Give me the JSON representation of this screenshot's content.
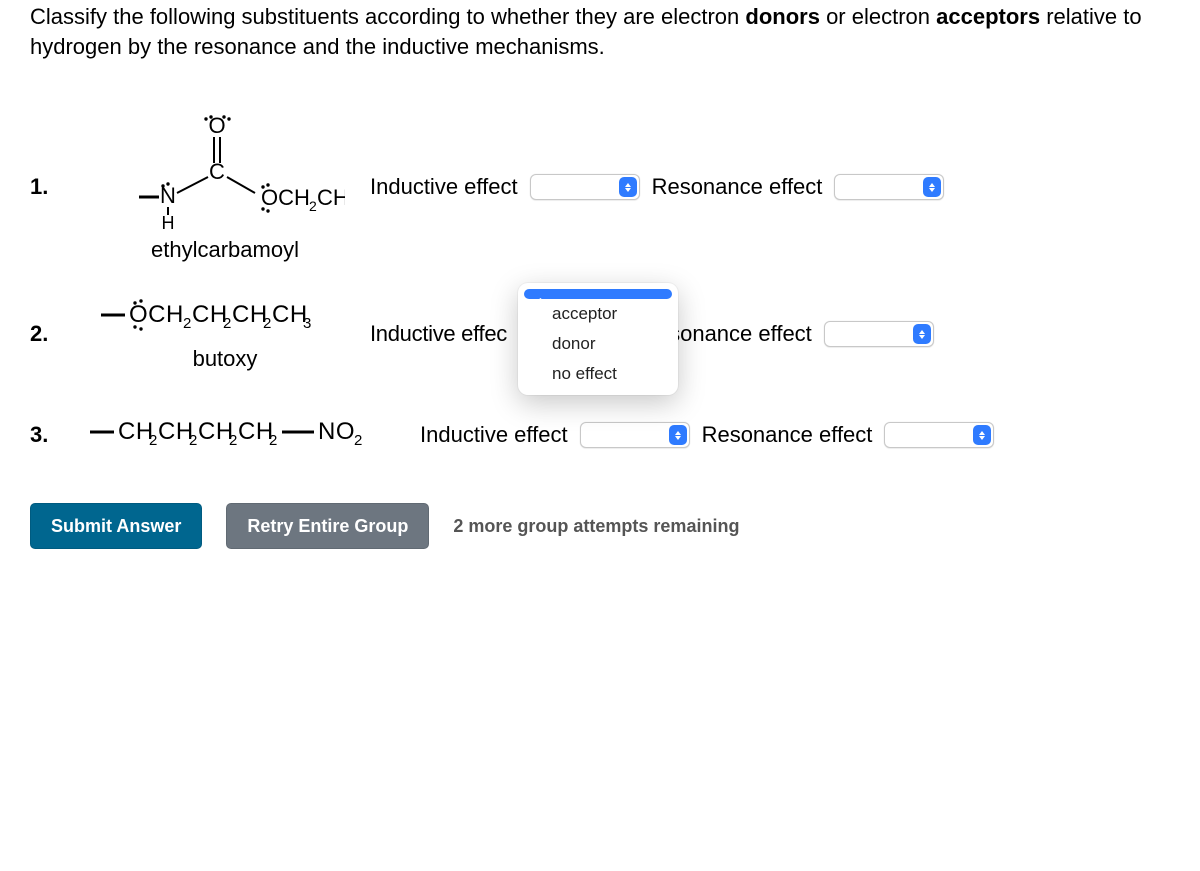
{
  "prompt_pre": "Classify the following substituents according to whether they are electron ",
  "prompt_b1": "donors",
  "prompt_mid": " or electron ",
  "prompt_b2": "acceptors",
  "prompt_post": " relative to hydrogen by the resonance and the inductive mechanisms.",
  "labels": {
    "inductive": "Inductive effect",
    "resonance": "Resonance effect"
  },
  "items": [
    {
      "num": "1.",
      "name": "ethylcarbamoyl"
    },
    {
      "num": "2.",
      "name": "butoxy"
    },
    {
      "num": "3.",
      "name": ""
    }
  ],
  "dropdown": {
    "options": [
      "",
      "acceptor",
      "donor",
      "no effect"
    ],
    "selected_index": 0
  },
  "buttons": {
    "submit": "Submit Answer",
    "retry": "Retry Entire Group"
  },
  "attempts_text": "2 more group attempts remaining",
  "chart_data": null
}
